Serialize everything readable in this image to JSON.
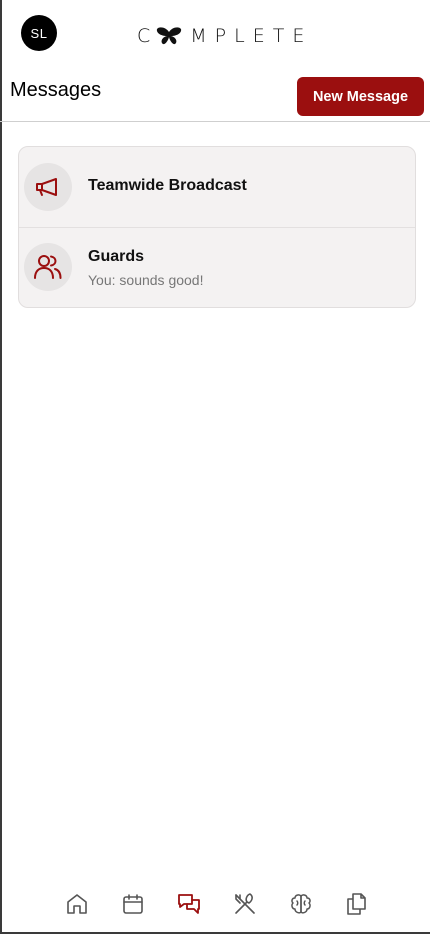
{
  "user": {
    "initials": "SL"
  },
  "brand": {
    "name": "COMPLETE",
    "logo_letters_left": "C",
    "logo_letters_right": "MPLETE"
  },
  "header": {
    "title": "Messages",
    "new_message_label": "New Message"
  },
  "conversations": [
    {
      "name": "Teamwide Broadcast",
      "preview": "",
      "icon": "megaphone-icon"
    },
    {
      "name": "Guards",
      "preview": "You: sounds good!",
      "icon": "users-icon"
    }
  ],
  "bottom_nav": [
    {
      "name": "home",
      "icon": "home-icon",
      "active": false
    },
    {
      "name": "calendar",
      "icon": "calendar-icon",
      "active": false
    },
    {
      "name": "messages",
      "icon": "messages-icon",
      "active": true
    },
    {
      "name": "nutrition",
      "icon": "utensils-icon",
      "active": false
    },
    {
      "name": "mental",
      "icon": "brain-icon",
      "active": false
    },
    {
      "name": "documents",
      "icon": "copy-icon",
      "active": false
    }
  ],
  "colors": {
    "accent": "#9b0f0f",
    "nav_inactive": "#555555",
    "card_bg": "#f4f2f2"
  }
}
